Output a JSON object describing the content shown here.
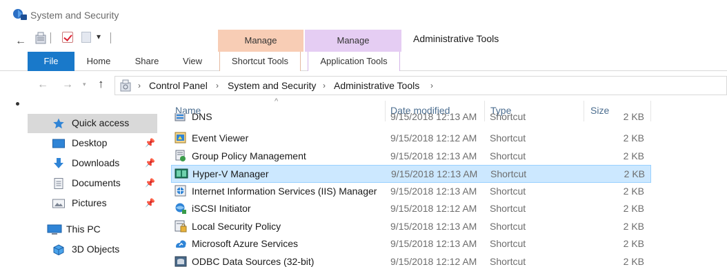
{
  "window": {
    "title": "System and Security"
  },
  "quick_access_toolbar": {
    "back_glyph": "←",
    "dropdown_glyph": "▾"
  },
  "ribbon": {
    "contextual": [
      {
        "header": "Manage",
        "tab": "Shortcut Tools",
        "color": "#f8cdb5"
      },
      {
        "header": "Manage",
        "tab": "Application Tools",
        "color": "#e5cdf3"
      }
    ],
    "context_title": "Administrative Tools",
    "tabs": [
      "File",
      "Home",
      "Share",
      "View"
    ],
    "file_tab_color": "#1979ca"
  },
  "address_bar": {
    "back_glyph": "←",
    "forward_glyph": "→",
    "recent_glyph": "▾",
    "up_glyph": "↑",
    "separator": "›",
    "breadcrumbs": [
      "Control Panel",
      "System and Security",
      "Administrative Tools"
    ]
  },
  "nav_pane": {
    "items": [
      {
        "label": "Quick access",
        "icon": "star-icon",
        "pinned": false,
        "selected": true
      },
      {
        "label": "Desktop",
        "icon": "desktop-folder-icon",
        "pinned": true
      },
      {
        "label": "Downloads",
        "icon": "downloads-icon",
        "pinned": true
      },
      {
        "label": "Documents",
        "icon": "documents-icon",
        "pinned": true
      },
      {
        "label": "Pictures",
        "icon": "pictures-icon",
        "pinned": true
      }
    ],
    "pin_glyph": "📌",
    "this_pc": {
      "label": "This PC",
      "icon": "computer-icon"
    },
    "this_pc_children": [
      {
        "label": "3D Objects",
        "icon": "cube-icon"
      }
    ]
  },
  "file_list": {
    "columns": [
      "Name",
      "Date modified",
      "Type",
      "Size"
    ],
    "sort_glyph": "^",
    "selected_color": "#cce8ff",
    "rows": [
      {
        "name": "DNS",
        "date": "9/15/2018 12:13 AM",
        "type": "Shortcut",
        "size": "2 KB",
        "icon": "dns-icon",
        "partial": true
      },
      {
        "name": "Event Viewer",
        "date": "9/15/2018 12:12 AM",
        "type": "Shortcut",
        "size": "2 KB",
        "icon": "event-viewer-icon"
      },
      {
        "name": "Group Policy Management",
        "date": "9/15/2018 12:13 AM",
        "type": "Shortcut",
        "size": "2 KB",
        "icon": "group-policy-icon"
      },
      {
        "name": "Hyper-V Manager",
        "date": "9/15/2018 12:13 AM",
        "type": "Shortcut",
        "size": "2 KB",
        "icon": "hyper-v-icon",
        "selected": true
      },
      {
        "name": "Internet Information Services (IIS) Manager",
        "date": "9/15/2018 12:13 AM",
        "type": "Shortcut",
        "size": "2 KB",
        "icon": "iis-icon"
      },
      {
        "name": "iSCSI Initiator",
        "date": "9/15/2018 12:12 AM",
        "type": "Shortcut",
        "size": "2 KB",
        "icon": "iscsi-icon"
      },
      {
        "name": "Local Security Policy",
        "date": "9/15/2018 12:13 AM",
        "type": "Shortcut",
        "size": "2 KB",
        "icon": "security-policy-icon"
      },
      {
        "name": "Microsoft Azure Services",
        "date": "9/15/2018 12:13 AM",
        "type": "Shortcut",
        "size": "2 KB",
        "icon": "azure-icon"
      },
      {
        "name": "ODBC Data Sources (32-bit)",
        "date": "9/15/2018 12:12 AM",
        "type": "Shortcut",
        "size": "2 KB",
        "icon": "odbc-icon"
      }
    ]
  }
}
